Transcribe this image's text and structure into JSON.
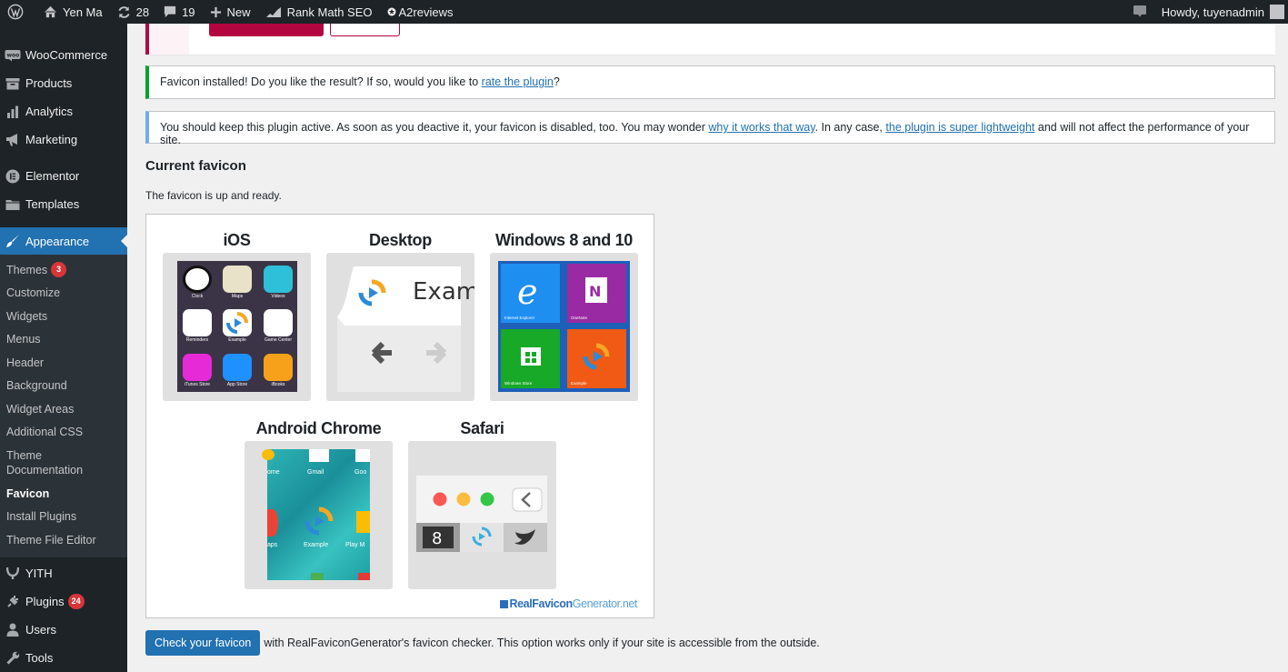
{
  "adminbar": {
    "site_name": "Yen Ma",
    "updates_count": "28",
    "comments_count": "19",
    "new_label": "New",
    "seo_label": "Rank Math SEO",
    "reviews_label": "A2reviews",
    "howdy": "Howdy, tuyenadmin"
  },
  "sidebar": {
    "top_items": [
      {
        "label": "WooCommerce",
        "icon": "woo-icon"
      },
      {
        "label": "Products",
        "icon": "archive-icon"
      },
      {
        "label": "Analytics",
        "icon": "bar-chart-icon"
      },
      {
        "label": "Marketing",
        "icon": "megaphone-icon"
      },
      {
        "label": "Elementor",
        "icon": "elementor-icon"
      },
      {
        "label": "Templates",
        "icon": "folder-icon"
      }
    ],
    "current": {
      "label": "Appearance",
      "icon": "paintbrush-icon"
    },
    "submenu": [
      {
        "label": "Themes",
        "badge": "3"
      },
      {
        "label": "Customize"
      },
      {
        "label": "Widgets"
      },
      {
        "label": "Menus"
      },
      {
        "label": "Header"
      },
      {
        "label": "Background"
      },
      {
        "label": "Widget Areas"
      },
      {
        "label": "Additional CSS"
      },
      {
        "label": "Theme Documentation"
      },
      {
        "label": "Favicon"
      },
      {
        "label": "Install Plugins"
      },
      {
        "label": "Theme File Editor"
      }
    ],
    "bottom_items": [
      {
        "label": "YITH",
        "icon": "yith-icon"
      },
      {
        "label": "Plugins",
        "icon": "plugin-icon",
        "badge": "24"
      },
      {
        "label": "Users",
        "icon": "user-icon"
      },
      {
        "label": "Tools",
        "icon": "wrench-icon"
      }
    ]
  },
  "notices": {
    "success_text": "Favicon installed! Do you like the result? If so, would you like to ",
    "success_link": "rate the plugin",
    "success_end": "?",
    "info_text1": "You should keep this plugin active. As soon as you deactive it, your favicon is disabled, too. You may wonder ",
    "info_link1": "why it works that way",
    "info_text2": ". In any case, ",
    "info_link2": "the plugin is super lightweight",
    "info_text3": " and will not affect the performance of your site."
  },
  "main": {
    "title": "Current favicon",
    "ready_text": "The favicon is up and ready.",
    "platforms": {
      "ios": "iOS",
      "desktop": "Desktop",
      "windows": "Windows 8 and 10",
      "android": "Android Chrome",
      "safari": "Safari"
    },
    "ios_apps": [
      "Clock",
      "Maps",
      "Videos",
      "Reminders",
      "Example",
      "Game Center",
      "iTunes Store",
      "App Store",
      "iBooks"
    ],
    "desktop_tab_text": "Exam",
    "windows_tiles": [
      "Internet Explorer",
      "OneNote",
      "Windows Store",
      "Example"
    ],
    "android_apps": [
      "ome",
      "Gmail",
      "Goo",
      "aps",
      "Example",
      "Play M"
    ],
    "rfg_brand_1": "RealFavicon",
    "rfg_brand_2": "Generator.net",
    "check_button": "Check your favicon",
    "check_text": " with RealFaviconGenerator's favicon checker. This option works only if your site is accessible from the outside."
  },
  "colors": {
    "admin_dark": "#1d2327",
    "accent_blue": "#2271b1",
    "success_green": "#00a32a",
    "info_blue": "#72aee6",
    "badge_red": "#d63638"
  }
}
